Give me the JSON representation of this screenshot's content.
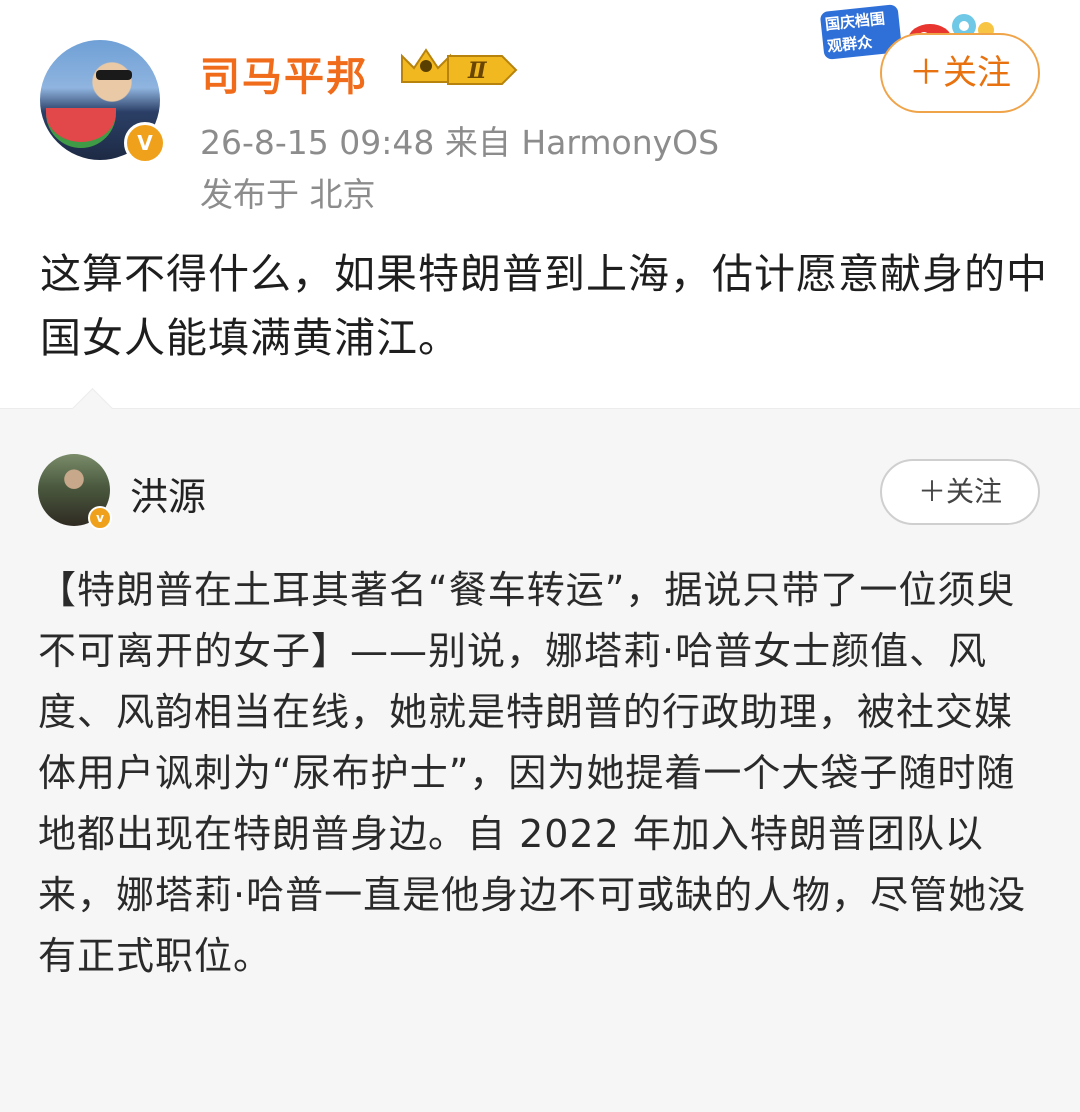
{
  "post": {
    "author": "司马平邦",
    "level_badge": "Ⅱ",
    "verified_badge": "V",
    "festival_sticker": "国庆档围观群众",
    "follow_label": "＋关注",
    "time_source": "26-8-15 09:48  来自 HarmonyOS",
    "location": "发布于 北京",
    "text": "这算不得什么，如果特朗普到上海，估计愿意献身的中国女人能填满黄浦江。"
  },
  "repost": {
    "author": "洪源",
    "verified_badge": "v",
    "follow_label": "＋关注",
    "text": "【特朗普在土耳其著名“餐车转运”，据说只带了一位须臾不可离开的女子】——别说，娜塔莉·哈普女士颜值、风度、风韵相当在线，她就是特朗普的行政助理，被社交媒体用户讽刺为“尿布护士”，因为她提着一个大袋子随时随地都出现在特朗普身边。自 2022 年加入特朗普团队以来，娜塔莉·哈普一直是他身边不可或缺的人物，尽管她没有正式职位。"
  },
  "colors": {
    "author_orange": "#f06b1a",
    "follow_orange": "#e8720f",
    "meta_gray": "#8c8c8c",
    "repost_bg": "#f6f6f6"
  }
}
